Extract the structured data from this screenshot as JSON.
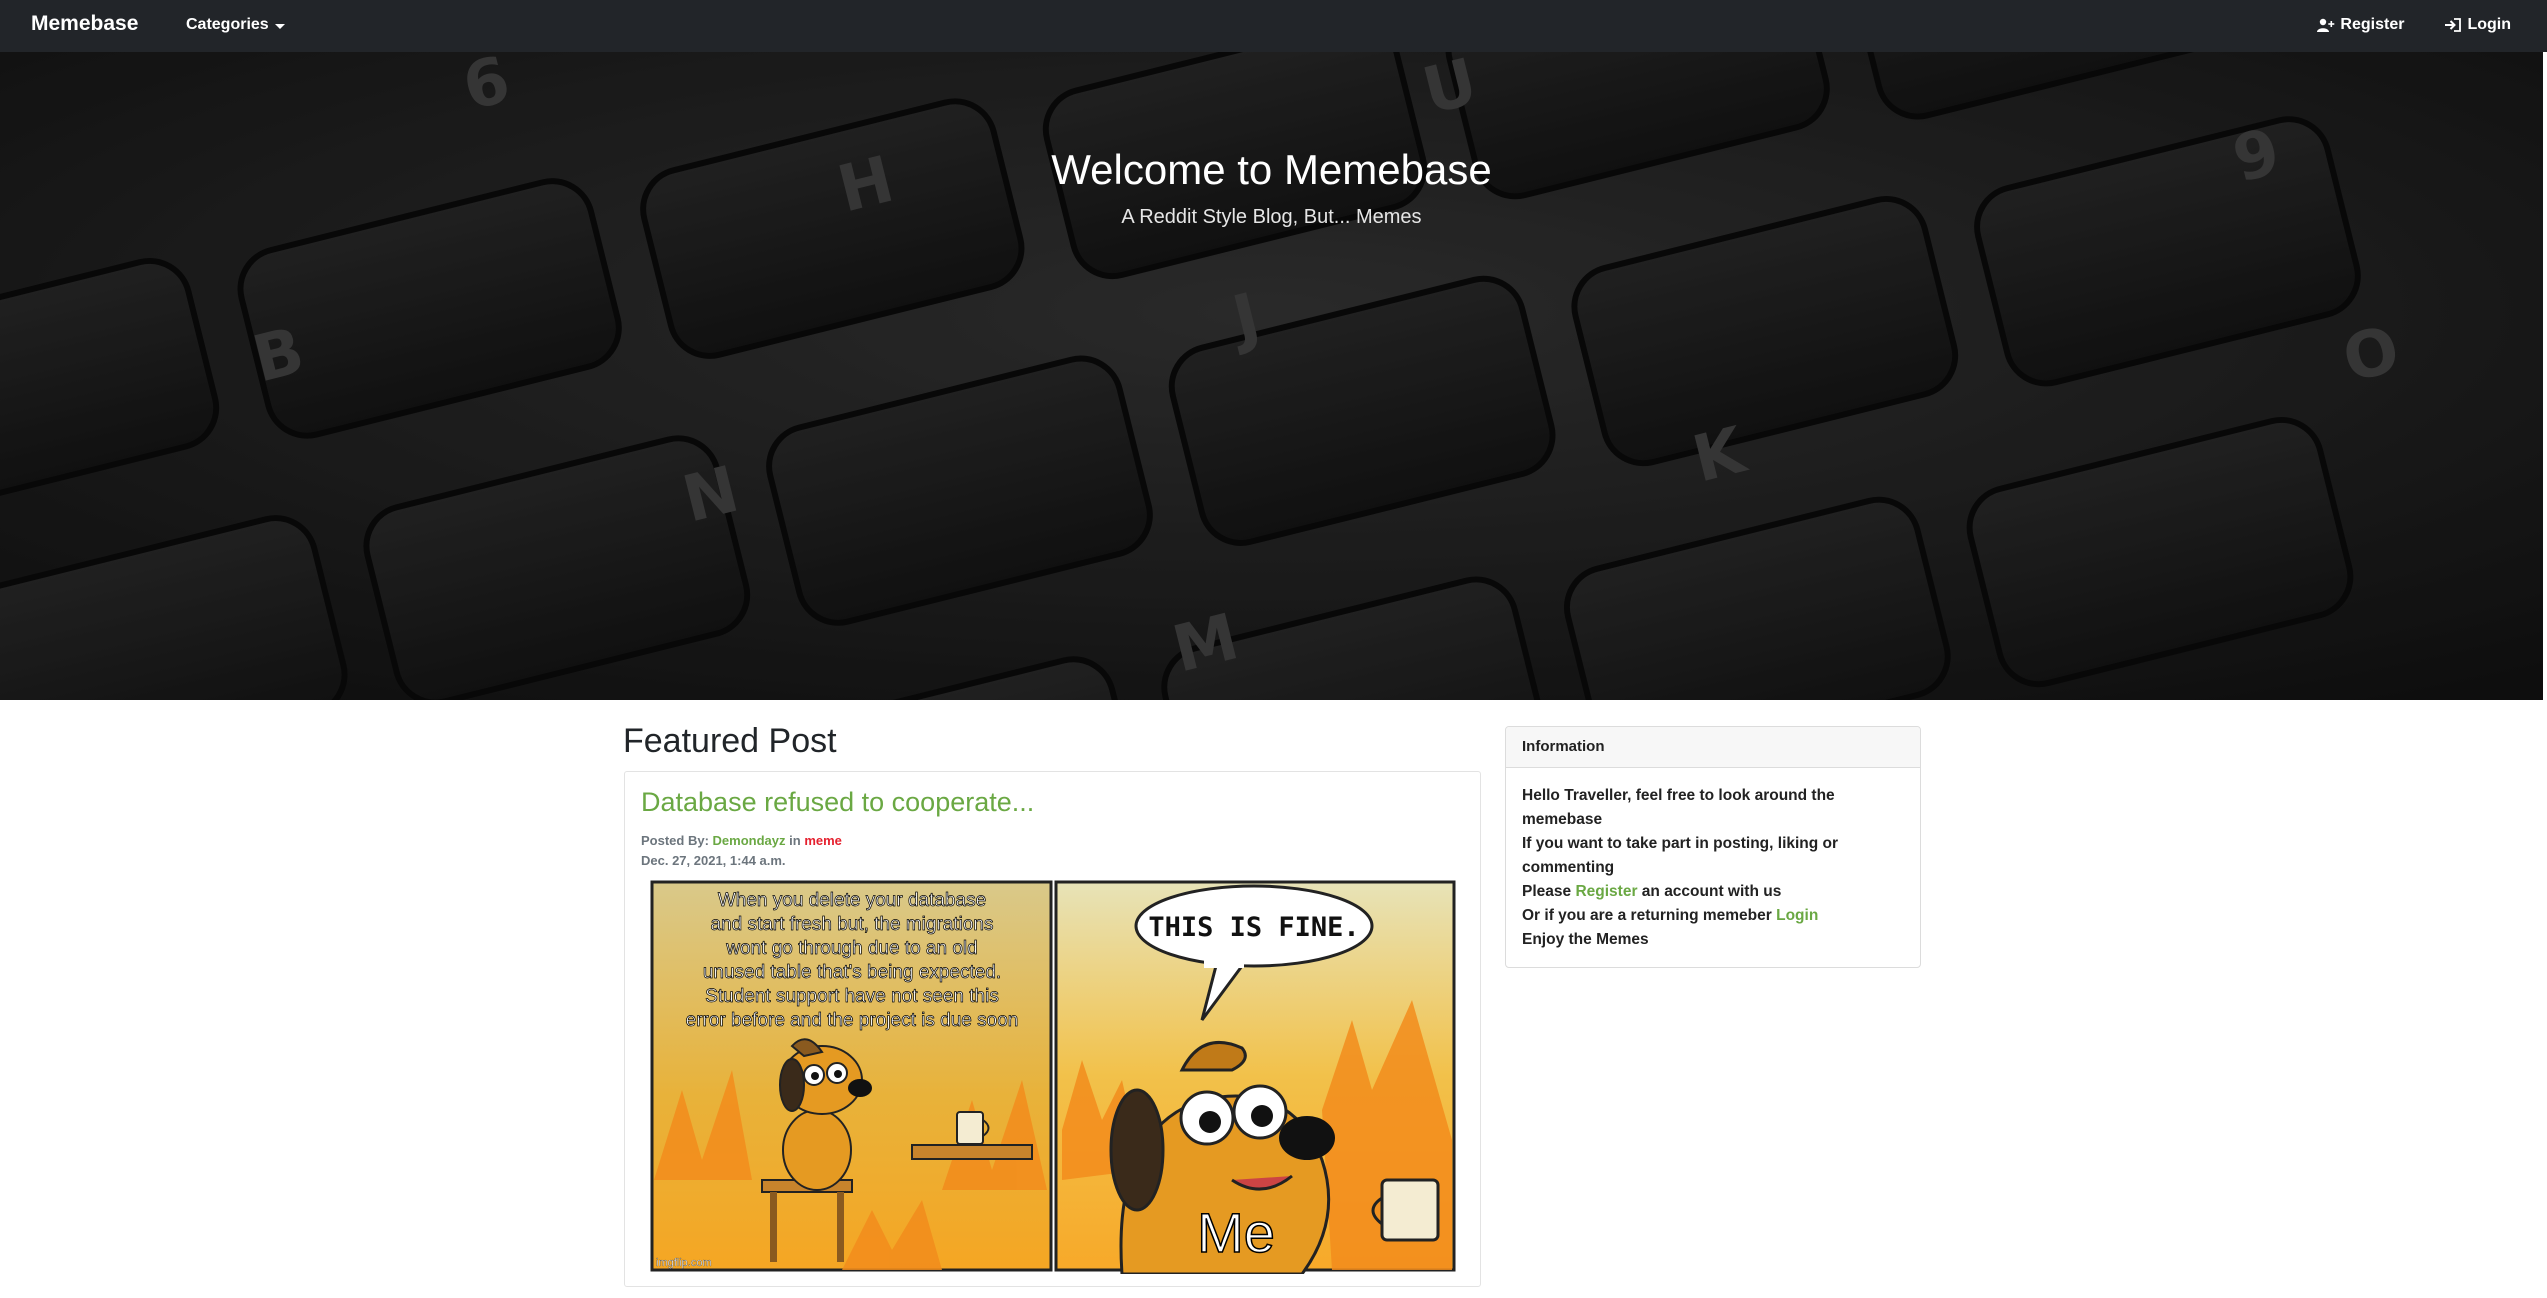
{
  "navbar": {
    "brand": "Memebase",
    "categories_label": "Categories",
    "register_label": "Register",
    "login_label": "Login"
  },
  "hero": {
    "title": "Welcome to Memebase",
    "subtitle": "A Reddit Style Blog, But... Memes"
  },
  "featured": {
    "section_title": "Featured Post",
    "post": {
      "title": "Database refused to cooperate...",
      "posted_by_label": "Posted By:",
      "author": "Demondayz",
      "in_label": "in",
      "category": "meme",
      "date": "Dec. 27, 2021, 1:44 a.m.",
      "meme_caption_lines": [
        "When you delete your database",
        "and start fresh but, the migrations",
        "wont go through due to an old",
        "unused table that's being expected.",
        "Student support have not seen this",
        "error before and the project is due soon"
      ],
      "meme_bubble": "THIS IS FINE.",
      "meme_me": "Me",
      "meme_watermark": "imgflip.com"
    }
  },
  "info": {
    "header": "Information",
    "line1": "Hello Traveller, feel free to look around the memebase",
    "line2": "If you want to take part in posting, liking or commenting",
    "line3_prefix": "Please",
    "line3_link": "Register",
    "line3_suffix": "an account with us",
    "line4_prefix": "Or if you are a returning memeber",
    "line4_link": "Login",
    "line5": "Enjoy the Memes"
  },
  "colors": {
    "navbar": "#222529",
    "accent_green": "#6aa843",
    "category_red": "#e5202e"
  }
}
